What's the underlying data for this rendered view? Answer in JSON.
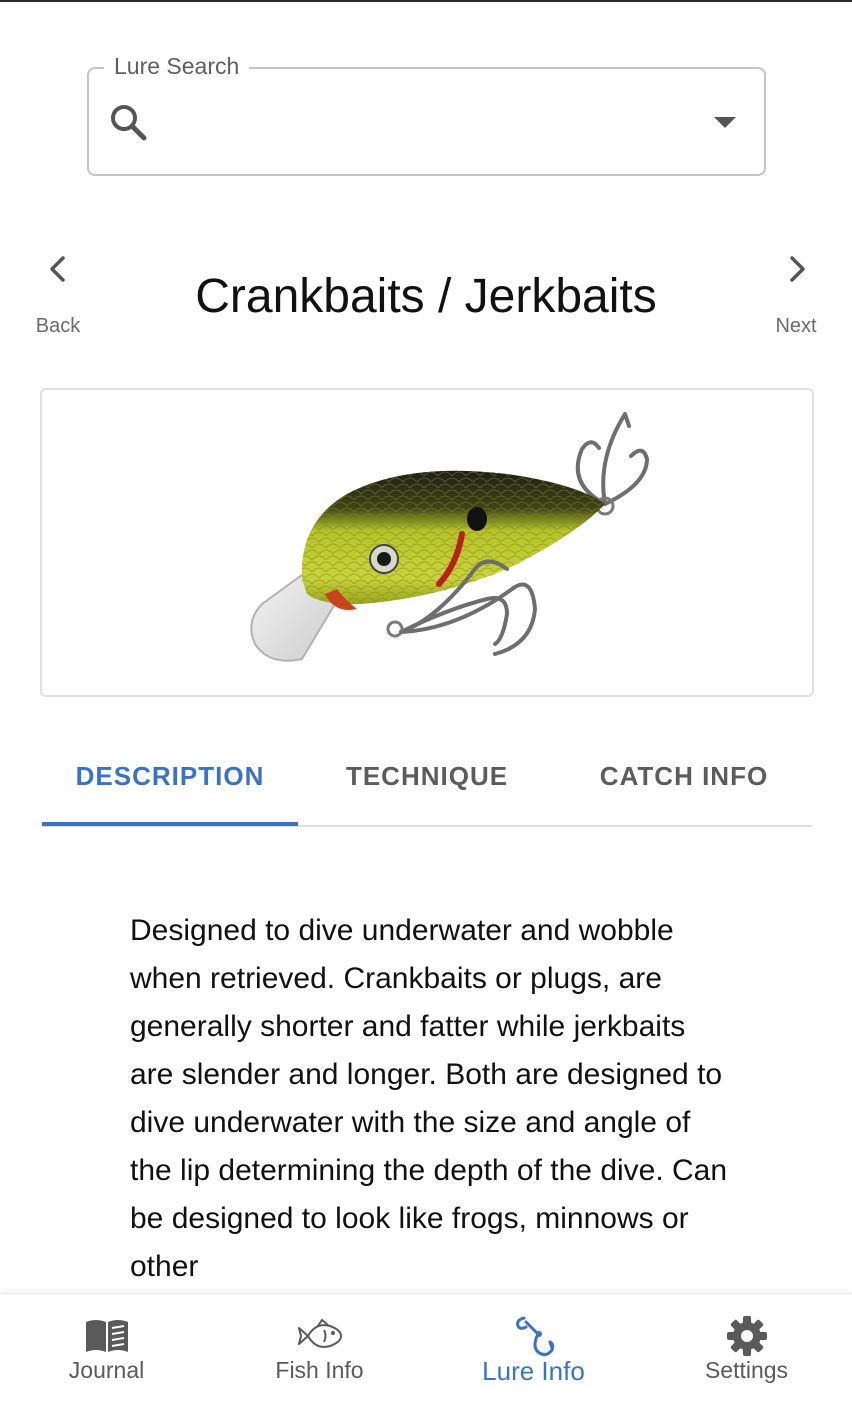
{
  "search": {
    "label": "Lure Search",
    "value": "",
    "placeholder": ""
  },
  "nav": {
    "back_label": "Back",
    "next_label": "Next"
  },
  "page_title": "Crankbaits / Jerkbaits",
  "tabs": [
    {
      "label": "DESCRIPTION",
      "active": true
    },
    {
      "label": "TECHNIQUE",
      "active": false
    },
    {
      "label": "CATCH INFO",
      "active": false
    }
  ],
  "description": "Designed to dive underwater and wobble when retrieved. Crankbaits or plugs, are generally shorter and fatter while jerkbaits are slender and longer. Both are designed to dive underwater with the size and angle of the lip determining the depth of the dive. Can be designed to look like frogs, minnows or other",
  "bottom_nav": [
    {
      "label": "Journal",
      "icon": "book-icon",
      "active": false
    },
    {
      "label": "Fish Info",
      "icon": "fish-icon",
      "active": false
    },
    {
      "label": "Lure Info",
      "icon": "hook-icon",
      "active": true
    },
    {
      "label": "Settings",
      "icon": "gear-icon",
      "active": false
    }
  ],
  "colors": {
    "accent": "#3a72c8",
    "inactive_text": "#5c5c5c",
    "border": "#c4c4c4"
  }
}
